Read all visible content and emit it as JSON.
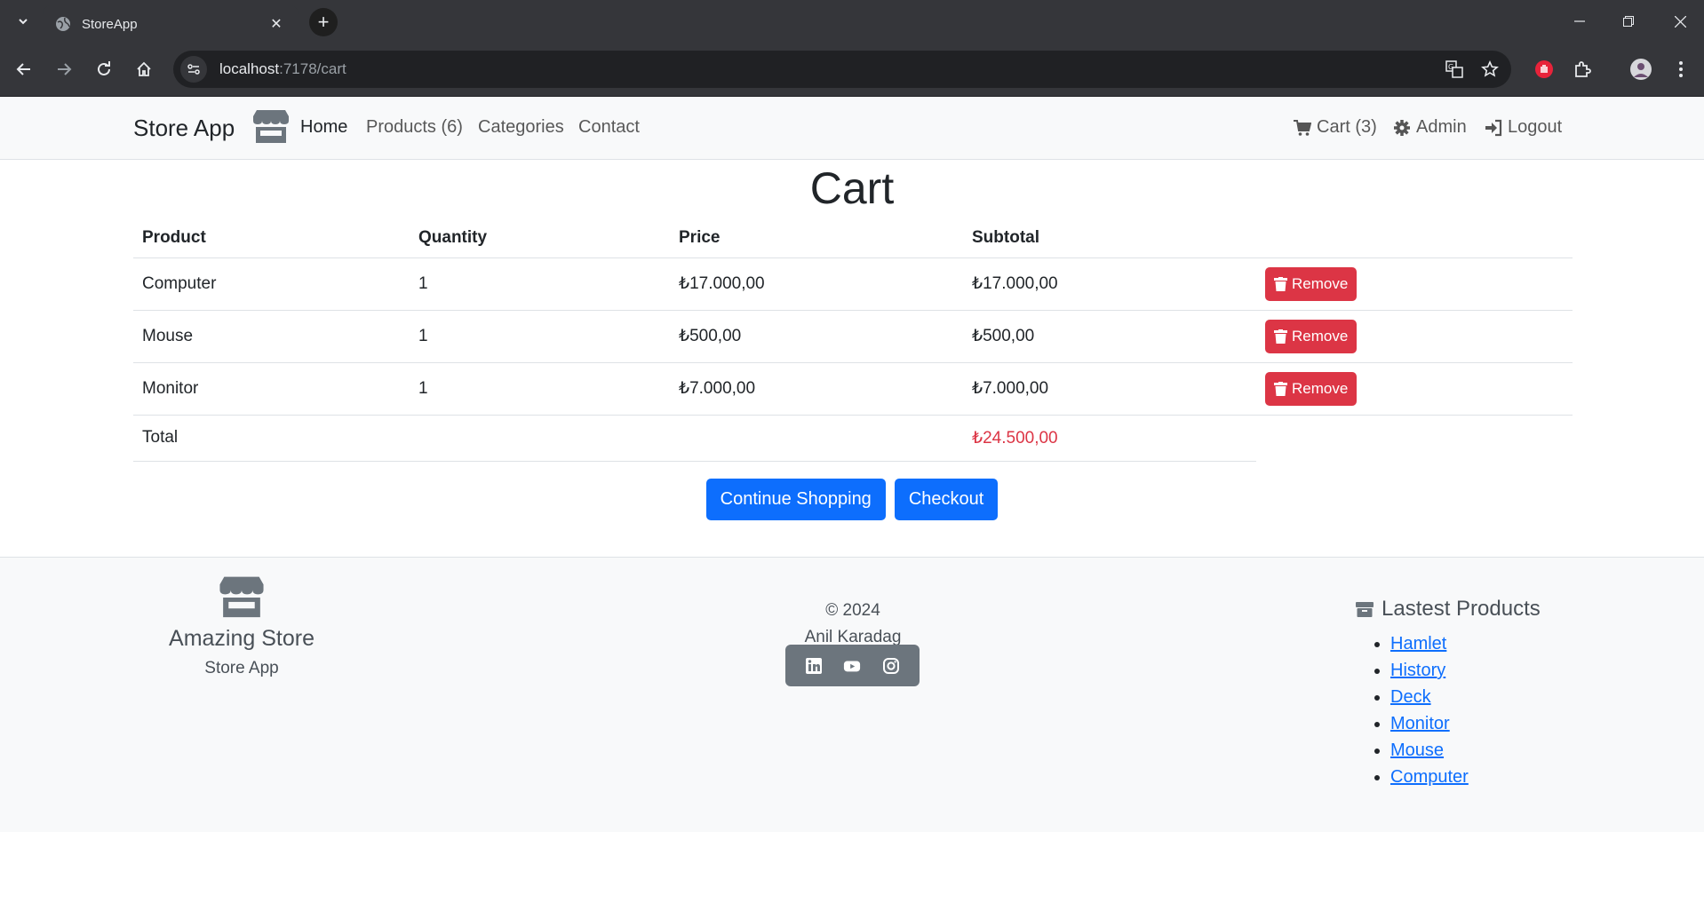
{
  "browser": {
    "tab_title": "StoreApp",
    "url_host": "localhost",
    "url_path": ":7178/cart"
  },
  "navbar": {
    "brand": "Store App",
    "links": [
      {
        "label": "Home"
      },
      {
        "label": "Products (6)"
      },
      {
        "label": "Categories"
      },
      {
        "label": "Contact"
      }
    ],
    "right_links": [
      {
        "label": "Cart (3)",
        "icon": "cart-icon"
      },
      {
        "label": "Admin",
        "icon": "gear-icon"
      },
      {
        "label": "Logout",
        "icon": "logout-icon"
      }
    ]
  },
  "cart": {
    "title": "Cart",
    "headers": [
      "Product",
      "Quantity",
      "Price",
      "Subtotal"
    ],
    "rows": [
      {
        "product": "Computer",
        "quantity": "1",
        "price": "₺17.000,00",
        "subtotal": "₺17.000,00",
        "action": "Remove"
      },
      {
        "product": "Mouse",
        "quantity": "1",
        "price": "₺500,00",
        "subtotal": "₺500,00",
        "action": "Remove"
      },
      {
        "product": "Monitor",
        "quantity": "1",
        "price": "₺7.000,00",
        "subtotal": "₺7.000,00",
        "action": "Remove"
      }
    ],
    "total_label": "Total",
    "total_value": "₺24.500,00",
    "continue_label": "Continue Shopping",
    "checkout_label": "Checkout"
  },
  "footer": {
    "store_name": "Amazing Store",
    "store_sub": "Store App",
    "copyright": "© 2024",
    "author": "Anil Karadag",
    "social": [
      "linkedin-icon",
      "youtube-icon",
      "instagram-icon"
    ],
    "latest_title": "Lastest Products",
    "latest_products": [
      "Hamlet",
      "History",
      "Deck",
      "Monitor",
      "Mouse",
      "Computer"
    ]
  },
  "colors": {
    "primary": "#0d6efd",
    "danger": "#dc3545",
    "secondary": "#6c757d"
  }
}
